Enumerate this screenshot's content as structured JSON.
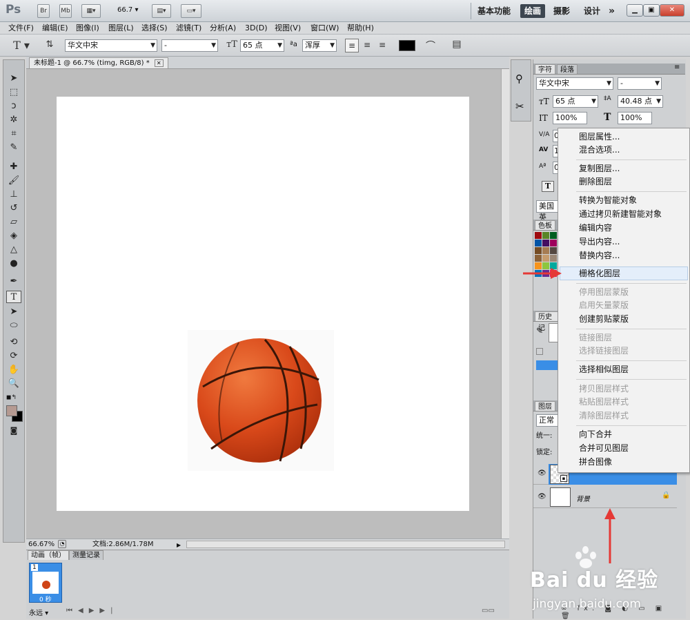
{
  "app": {
    "logo": "Ps",
    "bridge_btn": "Br",
    "minibridge_btn": "Mb",
    "zoom_value": "66.7",
    "workspaces": [
      "基本功能",
      "绘画",
      "摄影",
      "设计"
    ],
    "active_workspace": "绘画",
    "more": "»"
  },
  "menu": [
    "文件(F)",
    "编辑(E)",
    "图像(I)",
    "图层(L)",
    "选择(S)",
    "滤镜(T)",
    "分析(A)",
    "3D(D)",
    "视图(V)",
    "窗口(W)",
    "帮助(H)"
  ],
  "options": {
    "tool_glyph": "T",
    "font_family": "华文中宋",
    "font_style": "-",
    "font_size": "65 点",
    "aa_label": "a",
    "aa_mode": "浑厚",
    "color": "#000000"
  },
  "document": {
    "tab_title": "未标题-1 @ 66.7% (timg, RGB/8) *",
    "zoom": "66.67%",
    "doc_info": "文档:2.86M/1.78M"
  },
  "animation_panel": {
    "tabs": [
      "动画（帧）",
      "测量记录"
    ],
    "frame_number": "1",
    "frame_delay": "0 秒",
    "loop": "永远"
  },
  "character_panel": {
    "tabs": [
      "字符",
      "段落"
    ],
    "font_family": "华文中宋",
    "font_style": "-",
    "font_size": "65 点",
    "leading": "40.48 点",
    "vertical_scale": "100%",
    "horizontal_scale": "100%",
    "row4_value": "0",
    "row5_value": "1",
    "row6_value": "0",
    "language": "美国英"
  },
  "swatches_panel": {
    "tab": "色板",
    "colors": [
      "#ff0000",
      "#ffff00",
      "#00ff00",
      "#00ffff",
      "#0000ff",
      "#ff00ff",
      "#ff6a00",
      "#b0e000",
      "#00a651",
      "#00aeef",
      "#2e3192",
      "#92278f",
      "#f7941d",
      "#8dc63f",
      "#00a99d",
      "#0072bc",
      "#662d91",
      "#ed145b",
      "#9e0b0f",
      "#598527",
      "#005e20",
      "#0054a6",
      "#440e62",
      "#9e005d",
      "#754c24",
      "#a67c52",
      "#534741",
      "#8c6239",
      "#c69c6d",
      "#998675"
    ]
  },
  "history_panel": {
    "tab": "历史记"
  },
  "layers_panel": {
    "tab": "图层",
    "blend_mode": "正常",
    "unify_label": "统一:",
    "lock_label": "锁定:",
    "layers": [
      {
        "name": "timg",
        "selected": true
      },
      {
        "name": "背景",
        "selected": false
      }
    ],
    "fx": "fx."
  },
  "context_menu": {
    "items": [
      {
        "label": "图层属性...",
        "disabled": false
      },
      {
        "label": "混合选项...",
        "disabled": false
      },
      {
        "label": "复制图层...",
        "disabled": false
      },
      {
        "label": "删除图层",
        "disabled": false
      },
      {
        "label": "转换为智能对象",
        "disabled": false
      },
      {
        "label": "通过拷贝新建智能对象",
        "disabled": false
      },
      {
        "label": "编辑内容",
        "disabled": false
      },
      {
        "label": "导出内容...",
        "disabled": false
      },
      {
        "label": "替换内容...",
        "disabled": false
      },
      {
        "label": "栅格化图层",
        "disabled": false,
        "highlighted": true
      },
      {
        "label": "停用图层蒙版",
        "disabled": true
      },
      {
        "label": "启用矢量蒙版",
        "disabled": true
      },
      {
        "label": "创建剪贴蒙版",
        "disabled": false
      },
      {
        "label": "链接图层",
        "disabled": true
      },
      {
        "label": "选择链接图层",
        "disabled": true
      },
      {
        "label": "选择相似图层",
        "disabled": false
      },
      {
        "label": "拷贝图层样式",
        "disabled": true
      },
      {
        "label": "粘贴图层样式",
        "disabled": true
      },
      {
        "label": "清除图层样式",
        "disabled": true
      },
      {
        "label": "向下合并",
        "disabled": false
      },
      {
        "label": "合并可见图层",
        "disabled": false
      },
      {
        "label": "拼合图像",
        "disabled": false
      }
    ]
  },
  "watermark": {
    "brand": "Bai du 经验",
    "url": "jingyan.baidu.com"
  },
  "colors": {
    "accent_selected": "#3a8ee6",
    "arrow": "#e53935"
  }
}
